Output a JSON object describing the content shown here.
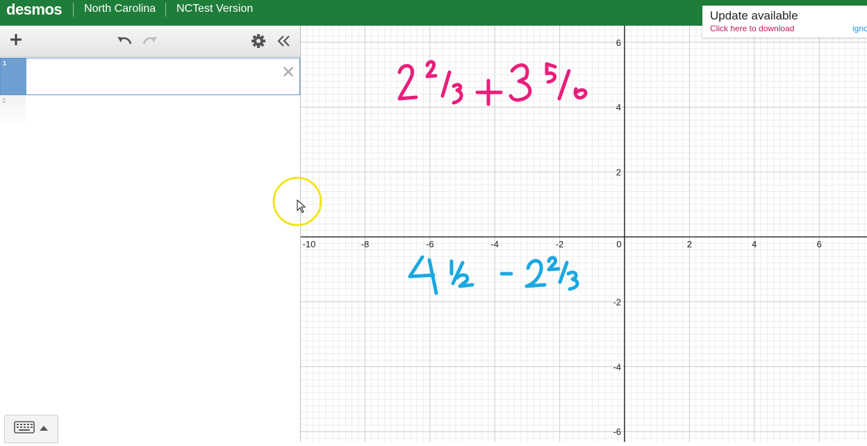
{
  "header": {
    "brand": "desmos",
    "links": [
      "North Carolina",
      "NCTest Version"
    ]
  },
  "notification": {
    "title": "Update available",
    "link": "Click here to download",
    "ignore": "igno"
  },
  "expression_list": {
    "rows": [
      {
        "index": "1",
        "value": ""
      },
      {
        "index": "2",
        "value": ""
      }
    ]
  },
  "graph": {
    "x_ticks": [
      "-10",
      "-8",
      "-6",
      "-4",
      "-2",
      "0",
      "2",
      "4",
      "6"
    ],
    "y_ticks_pos": [
      "6",
      "4",
      "2"
    ],
    "y_ticks_neg": [
      "-2",
      "-4",
      "-6"
    ],
    "handwriting": {
      "top": {
        "text": "2 2/3 + 3 5/6",
        "color": "#e91e7a"
      },
      "bottom": {
        "text": "4 1/2 - 2 2/3",
        "color": "#1ba8e0"
      }
    },
    "cursor_highlight_color": "#f2e51b"
  }
}
